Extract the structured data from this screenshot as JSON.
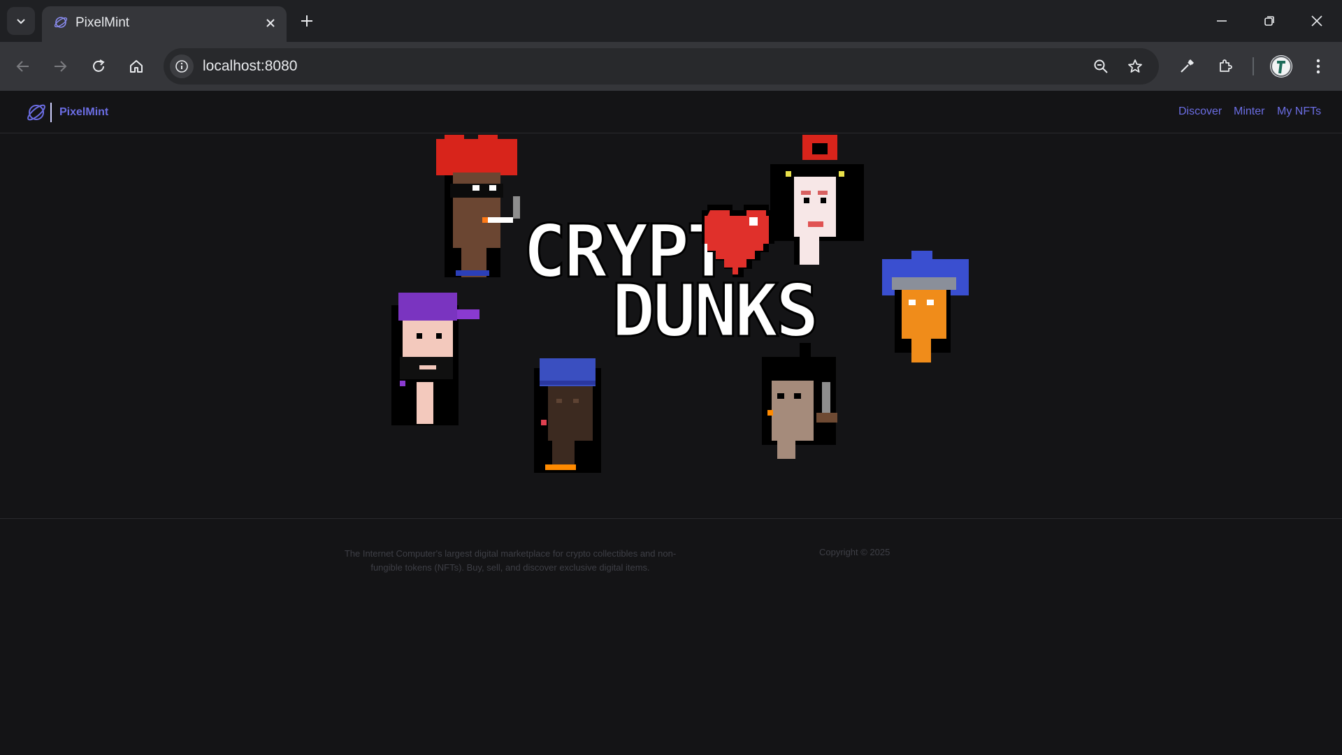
{
  "browser": {
    "tab_title": "PixelMint",
    "url": "localhost:8080"
  },
  "site": {
    "brand": "PixelMint",
    "nav": [
      {
        "label": "Discover"
      },
      {
        "label": "Minter"
      },
      {
        "label": "My NFTs"
      }
    ]
  },
  "hero": {
    "logo_line1": "CRYPT",
    "logo_line2": "DUNKS",
    "heart_color": "#e0302b",
    "characters": [
      "red-hair-smoker-punk",
      "red-bow-female-punk",
      "purple-cap-punk",
      "blue-beanie-punk",
      "orange-blue-hair-punk",
      "mohawk-pipe-punk"
    ]
  },
  "footer": {
    "description": "The Internet Computer's largest digital marketplace for crypto collectibles and non-fungible tokens (NFTs). Buy, sell, and discover exclusive digital items.",
    "copyright": "Copyright © 2025"
  },
  "colors": {
    "accent": "#6b6de3",
    "page_bg": "#141416",
    "chrome_bg": "#35363a"
  }
}
